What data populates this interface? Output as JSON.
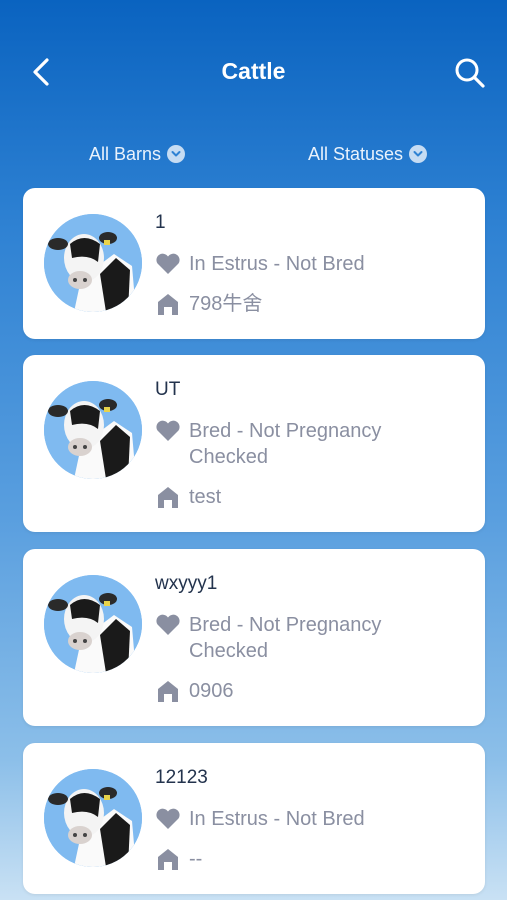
{
  "header": {
    "title": "Cattle",
    "back_icon": "back-chevron-icon",
    "search_icon": "search-icon"
  },
  "filters": {
    "barns_label": "All Barns",
    "status_label": "All Statuses"
  },
  "colors": {
    "header_top": "#0a63c0",
    "card_bg": "#ffffff",
    "icon_gray": "#8a8fa1",
    "name_text": "#23334d"
  },
  "cattle": [
    {
      "name": "1",
      "status": "In Estrus - Not Bred",
      "barn": "798牛舍"
    },
    {
      "name": "UT",
      "status": "Bred - Not Pregnancy Checked",
      "barn": "test"
    },
    {
      "name": "wxyyy1",
      "status": "Bred - Not Pregnancy Checked",
      "barn": "0906"
    },
    {
      "name": "12123",
      "status": "In Estrus - Not Bred",
      "barn": "--"
    }
  ]
}
